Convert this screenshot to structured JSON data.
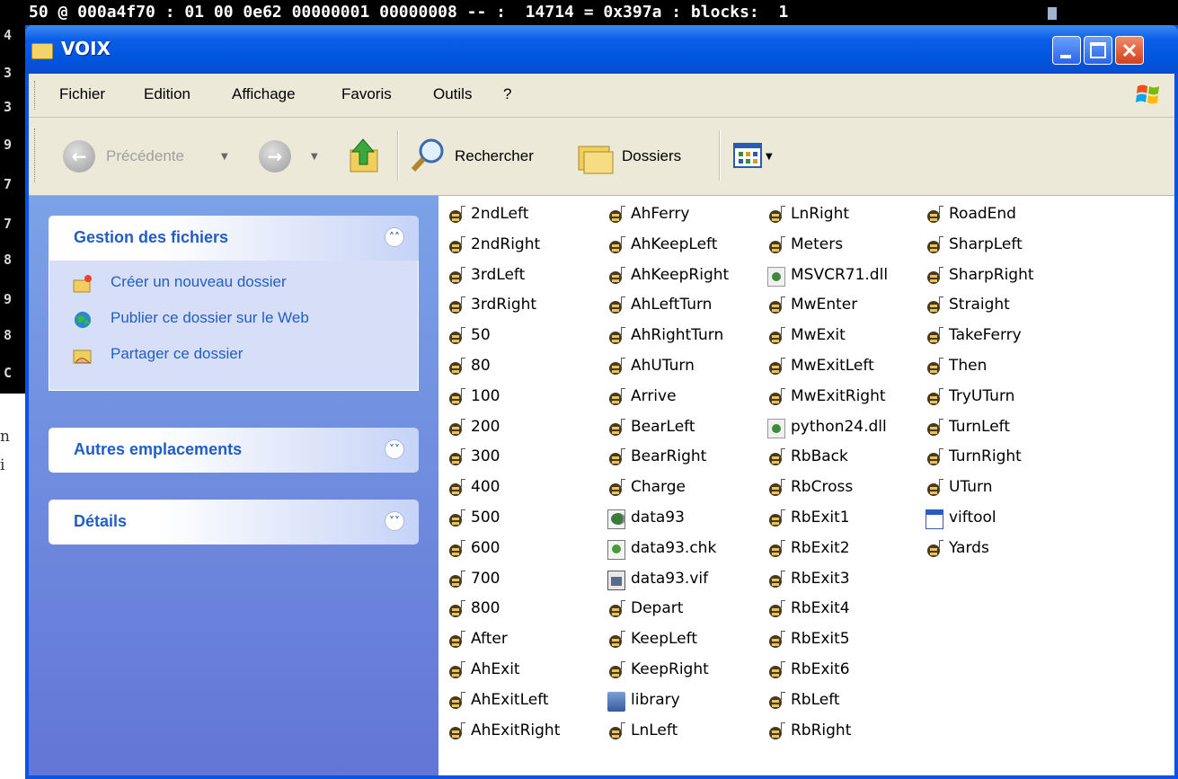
{
  "background": {
    "console_line": "50 @ 000a4f70 : 01 00 0e62 00000001 00000008 -- :  14714 = 0x397a : blocks:  1",
    "side_digits": [
      "4",
      "3",
      "3",
      "9",
      "7",
      "7",
      "8",
      "9",
      "8",
      "C"
    ],
    "side_text": [
      "n",
      "i"
    ]
  },
  "window": {
    "title": "VOIX",
    "title_icon": "folder-icon",
    "controls": [
      "minimize",
      "maximize",
      "close"
    ]
  },
  "menubar": {
    "items": [
      "Fichier",
      "Edition",
      "Affichage",
      "Favoris",
      "Outils",
      "?"
    ]
  },
  "toolbar": {
    "back_label": "Précédente",
    "search_label": "Rechercher",
    "folders_label": "Dossiers",
    "icons": [
      "back-arrow-icon",
      "forward-arrow-icon",
      "folder-up-icon",
      "search-icon",
      "folders-icon",
      "views-icon"
    ]
  },
  "tasks": {
    "file_tasks": {
      "title": "Gestion des fichiers",
      "items": [
        {
          "label": "Créer un nouveau dossier",
          "icon": "new-folder-icon"
        },
        {
          "label": "Publier ce dossier sur le Web",
          "icon": "publish-web-icon"
        },
        {
          "label": "Partager ce dossier",
          "icon": "share-folder-icon"
        }
      ]
    },
    "other_places": {
      "title": "Autres emplacements"
    },
    "details": {
      "title": "Détails"
    }
  },
  "files": {
    "columns": [
      [
        {
          "name": "2ndLeft",
          "type": "snd"
        },
        {
          "name": "2ndRight",
          "type": "snd"
        },
        {
          "name": "3rdLeft",
          "type": "snd"
        },
        {
          "name": "3rdRight",
          "type": "snd"
        },
        {
          "name": "50",
          "type": "snd"
        },
        {
          "name": "80",
          "type": "snd"
        },
        {
          "name": "100",
          "type": "snd"
        },
        {
          "name": "200",
          "type": "snd"
        },
        {
          "name": "300",
          "type": "snd"
        },
        {
          "name": "400",
          "type": "snd"
        },
        {
          "name": "500",
          "type": "snd"
        },
        {
          "name": "600",
          "type": "snd"
        },
        {
          "name": "700",
          "type": "snd"
        },
        {
          "name": "800",
          "type": "snd"
        },
        {
          "name": "After",
          "type": "snd"
        },
        {
          "name": "AhExit",
          "type": "snd"
        },
        {
          "name": "AhExitLeft",
          "type": "snd"
        },
        {
          "name": "AhExitRight",
          "type": "snd"
        }
      ],
      [
        {
          "name": "AhFerry",
          "type": "snd"
        },
        {
          "name": "AhKeepLeft",
          "type": "snd"
        },
        {
          "name": "AhKeepRight",
          "type": "snd"
        },
        {
          "name": "AhLeftTurn",
          "type": "snd"
        },
        {
          "name": "AhRightTurn",
          "type": "snd"
        },
        {
          "name": "AhUTurn",
          "type": "snd"
        },
        {
          "name": "Arrive",
          "type": "snd"
        },
        {
          "name": "BearLeft",
          "type": "snd"
        },
        {
          "name": "BearRight",
          "type": "snd"
        },
        {
          "name": "Charge",
          "type": "snd"
        },
        {
          "name": "data93",
          "type": "generic"
        },
        {
          "name": "data93.chk",
          "type": "chk"
        },
        {
          "name": "data93.vif",
          "type": "vif"
        },
        {
          "name": "Depart",
          "type": "snd"
        },
        {
          "name": "KeepLeft",
          "type": "snd"
        },
        {
          "name": "KeepRight",
          "type": "snd"
        },
        {
          "name": "library",
          "type": "lib"
        },
        {
          "name": "LnLeft",
          "type": "snd"
        }
      ],
      [
        {
          "name": "LnRight",
          "type": "snd"
        },
        {
          "name": "Meters",
          "type": "snd"
        },
        {
          "name": "MSVCR71.dll",
          "type": "dll"
        },
        {
          "name": "MwEnter",
          "type": "snd"
        },
        {
          "name": "MwExit",
          "type": "snd"
        },
        {
          "name": "MwExitLeft",
          "type": "snd"
        },
        {
          "name": "MwExitRight",
          "type": "snd"
        },
        {
          "name": "python24.dll",
          "type": "dll"
        },
        {
          "name": "RbBack",
          "type": "snd"
        },
        {
          "name": "RbCross",
          "type": "snd"
        },
        {
          "name": "RbExit1",
          "type": "snd"
        },
        {
          "name": "RbExit2",
          "type": "snd"
        },
        {
          "name": "RbExit3",
          "type": "snd"
        },
        {
          "name": "RbExit4",
          "type": "snd"
        },
        {
          "name": "RbExit5",
          "type": "snd"
        },
        {
          "name": "RbExit6",
          "type": "snd"
        },
        {
          "name": "RbLeft",
          "type": "snd"
        },
        {
          "name": "RbRight",
          "type": "snd"
        }
      ],
      [
        {
          "name": "RoadEnd",
          "type": "snd"
        },
        {
          "name": "SharpLeft",
          "type": "snd"
        },
        {
          "name": "SharpRight",
          "type": "snd"
        },
        {
          "name": "Straight",
          "type": "snd"
        },
        {
          "name": "TakeFerry",
          "type": "snd"
        },
        {
          "name": "Then",
          "type": "snd"
        },
        {
          "name": "TryUTurn",
          "type": "snd"
        },
        {
          "name": "TurnLeft",
          "type": "snd"
        },
        {
          "name": "TurnRight",
          "type": "snd"
        },
        {
          "name": "UTurn",
          "type": "snd"
        },
        {
          "name": "viftool",
          "type": "exe"
        },
        {
          "name": "Yards",
          "type": "snd"
        }
      ]
    ]
  },
  "colors": {
    "titlebar": "#0a5ee6",
    "task_pane": "#7ba2e7",
    "task_link": "#215dc6",
    "chrome": "#ece9d8"
  }
}
